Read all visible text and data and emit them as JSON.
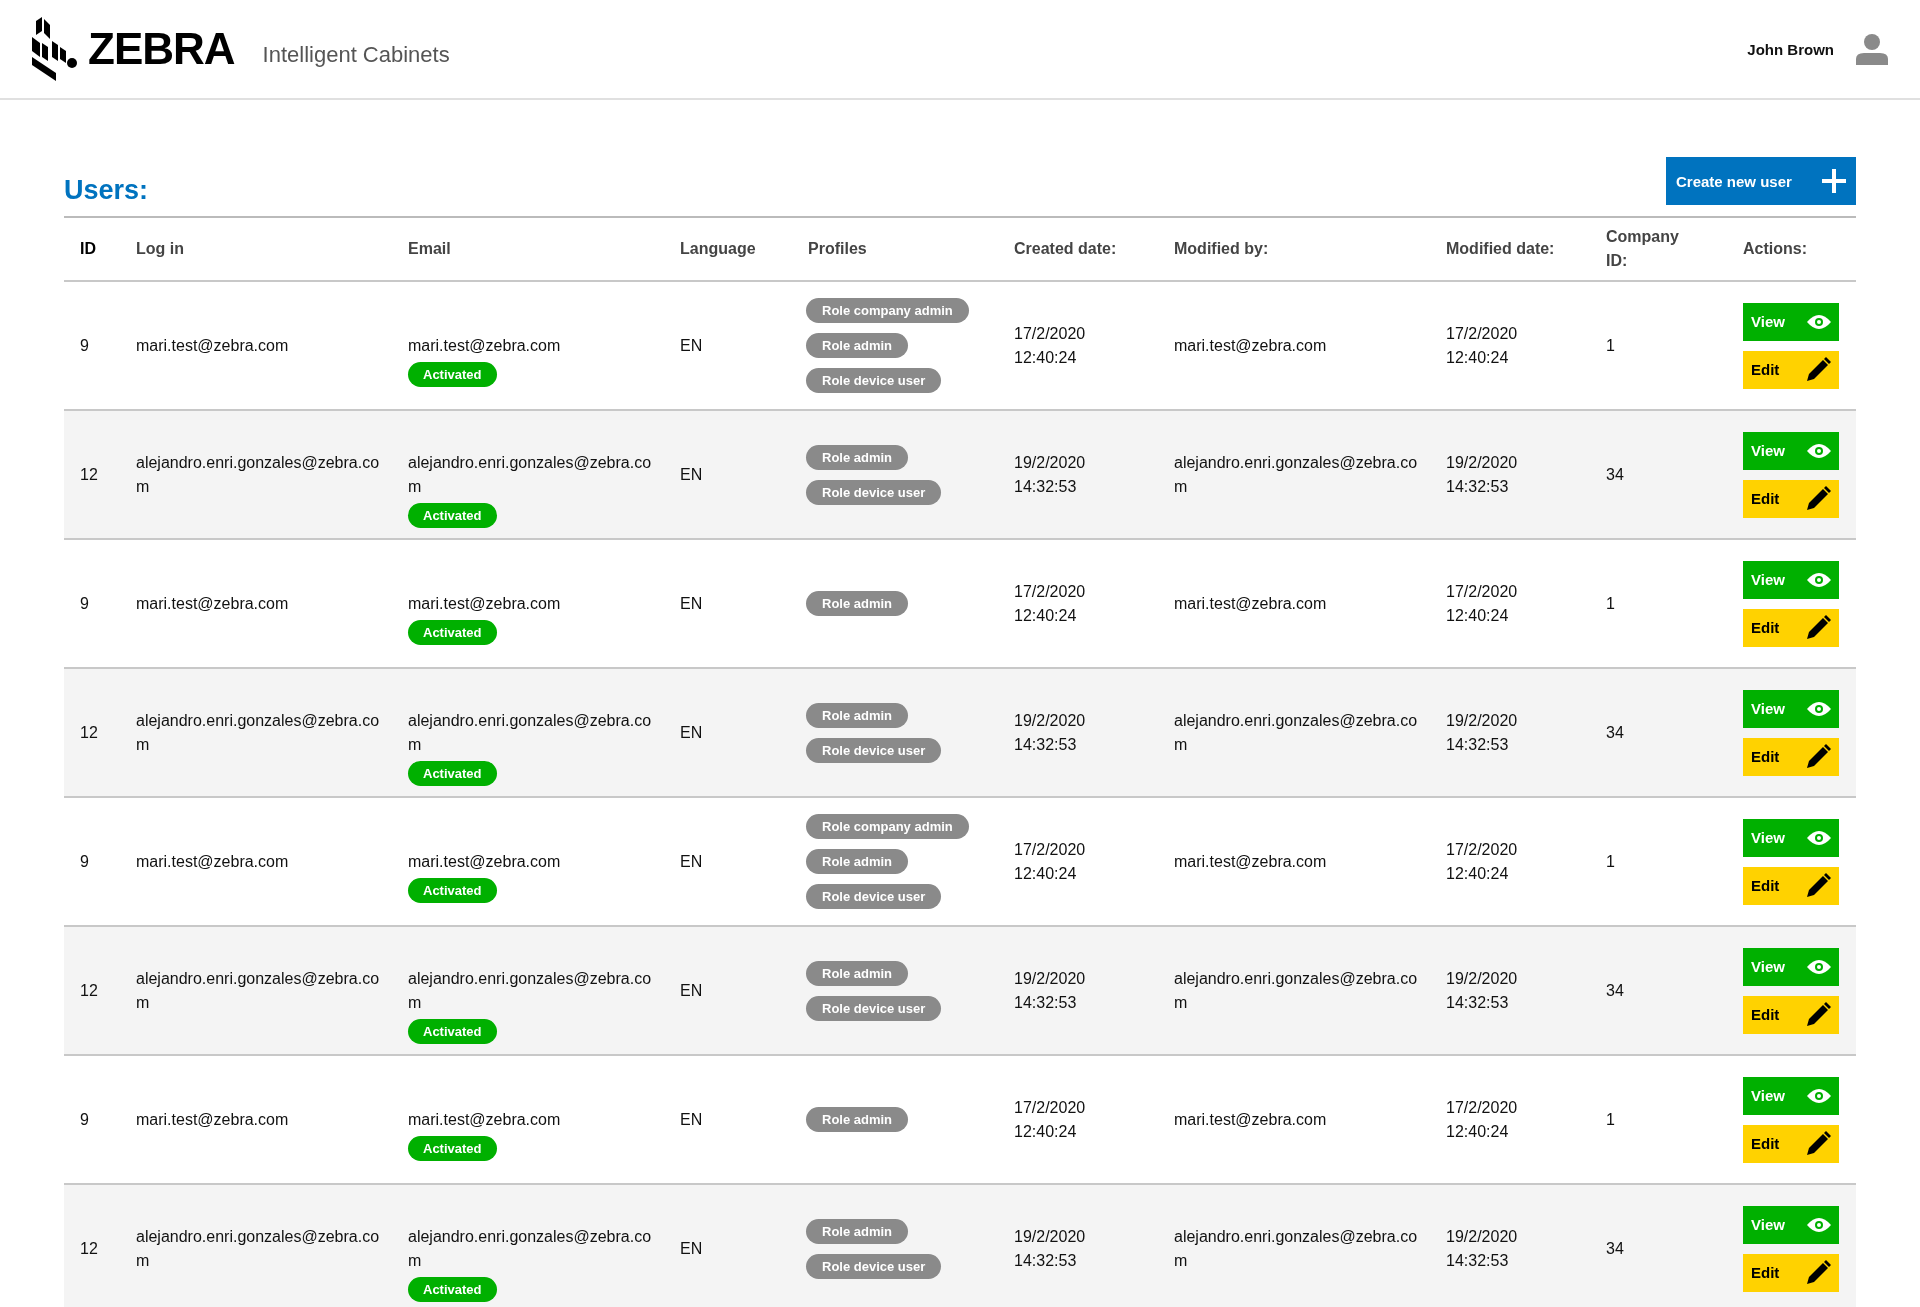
{
  "header": {
    "logo_text": "ZEBRA",
    "app_name": "Intelligent Cabinets",
    "user_name": "John Brown"
  },
  "page": {
    "title": "Users:",
    "create_button": "Create new user"
  },
  "table": {
    "columns": [
      "ID",
      "Log in",
      "Email",
      "Language",
      "Profiles",
      "Created date:",
      "Modified by:",
      "Modified date:",
      "Company ID:",
      "Actions:"
    ],
    "rows": [
      {
        "id": "9",
        "login": "mari.test@zebra.com",
        "email": "mari.test@zebra.com",
        "status": "Activated",
        "language": "EN",
        "profiles": [
          "Role company admin",
          "Role admin",
          "Role device user"
        ],
        "created_date": "17/2/2020",
        "created_time": "12:40:24",
        "modified_by": "mari.test@zebra.com",
        "modified_date": "17/2/2020",
        "modified_time": "12:40:24",
        "company_id": "1",
        "actions": [
          "View",
          "Edit"
        ]
      },
      {
        "id": "12",
        "login": "alejandro.enri.gonzales@zebra.com",
        "email": "alejandro.enri.gonzales@zebra.com",
        "status": "Activated",
        "language": "EN",
        "profiles": [
          "Role admin",
          "Role device user"
        ],
        "created_date": "19/2/2020",
        "created_time": "14:32:53",
        "modified_by": "alejandro.enri.gonzales@zebra.com",
        "modified_date": "19/2/2020",
        "modified_time": "14:32:53",
        "company_id": "34",
        "actions": [
          "View",
          "Edit"
        ]
      },
      {
        "id": "9",
        "login": "mari.test@zebra.com",
        "email": "mari.test@zebra.com",
        "status": "Activated",
        "language": "EN",
        "profiles": [
          "Role admin"
        ],
        "created_date": "17/2/2020",
        "created_time": "12:40:24",
        "modified_by": "mari.test@zebra.com",
        "modified_date": "17/2/2020",
        "modified_time": "12:40:24",
        "company_id": "1",
        "actions": [
          "View",
          "Edit"
        ]
      },
      {
        "id": "12",
        "login": "alejandro.enri.gonzales@zebra.com",
        "email": "alejandro.enri.gonzales@zebra.com",
        "status": "Activated",
        "language": "EN",
        "profiles": [
          "Role admin",
          "Role device user"
        ],
        "created_date": "19/2/2020",
        "created_time": "14:32:53",
        "modified_by": "alejandro.enri.gonzales@zebra.com",
        "modified_date": "19/2/2020",
        "modified_time": "14:32:53",
        "company_id": "34",
        "actions": [
          "View",
          "Edit"
        ]
      },
      {
        "id": "9",
        "login": "mari.test@zebra.com",
        "email": "mari.test@zebra.com",
        "status": "Activated",
        "language": "EN",
        "profiles": [
          "Role company admin",
          "Role admin",
          "Role device user"
        ],
        "created_date": "17/2/2020",
        "created_time": "12:40:24",
        "modified_by": "mari.test@zebra.com",
        "modified_date": "17/2/2020",
        "modified_time": "12:40:24",
        "company_id": "1",
        "actions": [
          "View",
          "Edit"
        ]
      },
      {
        "id": "12",
        "login": "alejandro.enri.gonzales@zebra.com",
        "email": "alejandro.enri.gonzales@zebra.com",
        "status": "Activated",
        "language": "EN",
        "profiles": [
          "Role admin",
          "Role device user"
        ],
        "created_date": "19/2/2020",
        "created_time": "14:32:53",
        "modified_by": "alejandro.enri.gonzales@zebra.com",
        "modified_date": "19/2/2020",
        "modified_time": "14:32:53",
        "company_id": "34",
        "actions": [
          "View",
          "Edit"
        ]
      },
      {
        "id": "9",
        "login": "mari.test@zebra.com",
        "email": "mari.test@zebra.com",
        "status": "Activated",
        "language": "EN",
        "profiles": [
          "Role admin"
        ],
        "created_date": "17/2/2020",
        "created_time": "12:40:24",
        "modified_by": "mari.test@zebra.com",
        "modified_date": "17/2/2020",
        "modified_time": "12:40:24",
        "company_id": "1",
        "actions": [
          "View",
          "Edit"
        ]
      },
      {
        "id": "12",
        "login": "alejandro.enri.gonzales@zebra.com",
        "email": "alejandro.enri.gonzales@zebra.com",
        "status": "Activated",
        "language": "EN",
        "profiles": [
          "Role admin",
          "Role device user"
        ],
        "created_date": "19/2/2020",
        "created_time": "14:32:53",
        "modified_by": "alejandro.enri.gonzales@zebra.com",
        "modified_date": "19/2/2020",
        "modified_time": "14:32:53",
        "company_id": "34",
        "actions": [
          "View",
          "Edit"
        ]
      }
    ]
  }
}
